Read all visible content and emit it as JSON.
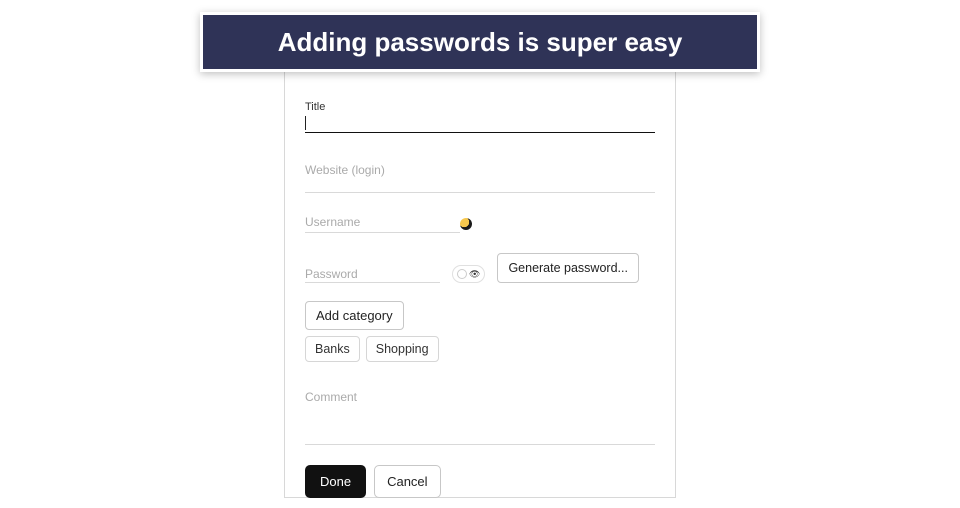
{
  "banner": {
    "text": "Adding passwords is super easy"
  },
  "form": {
    "title": {
      "label": "Title",
      "value": ""
    },
    "website": {
      "label": "Website (login)"
    },
    "username": {
      "label": "Username"
    },
    "password": {
      "label": "Password"
    },
    "generate_label": "Generate password...",
    "add_category_label": "Add category",
    "categories": [
      "Banks",
      "Shopping"
    ],
    "comment": {
      "label": "Comment"
    },
    "done_label": "Done",
    "cancel_label": "Cancel"
  }
}
